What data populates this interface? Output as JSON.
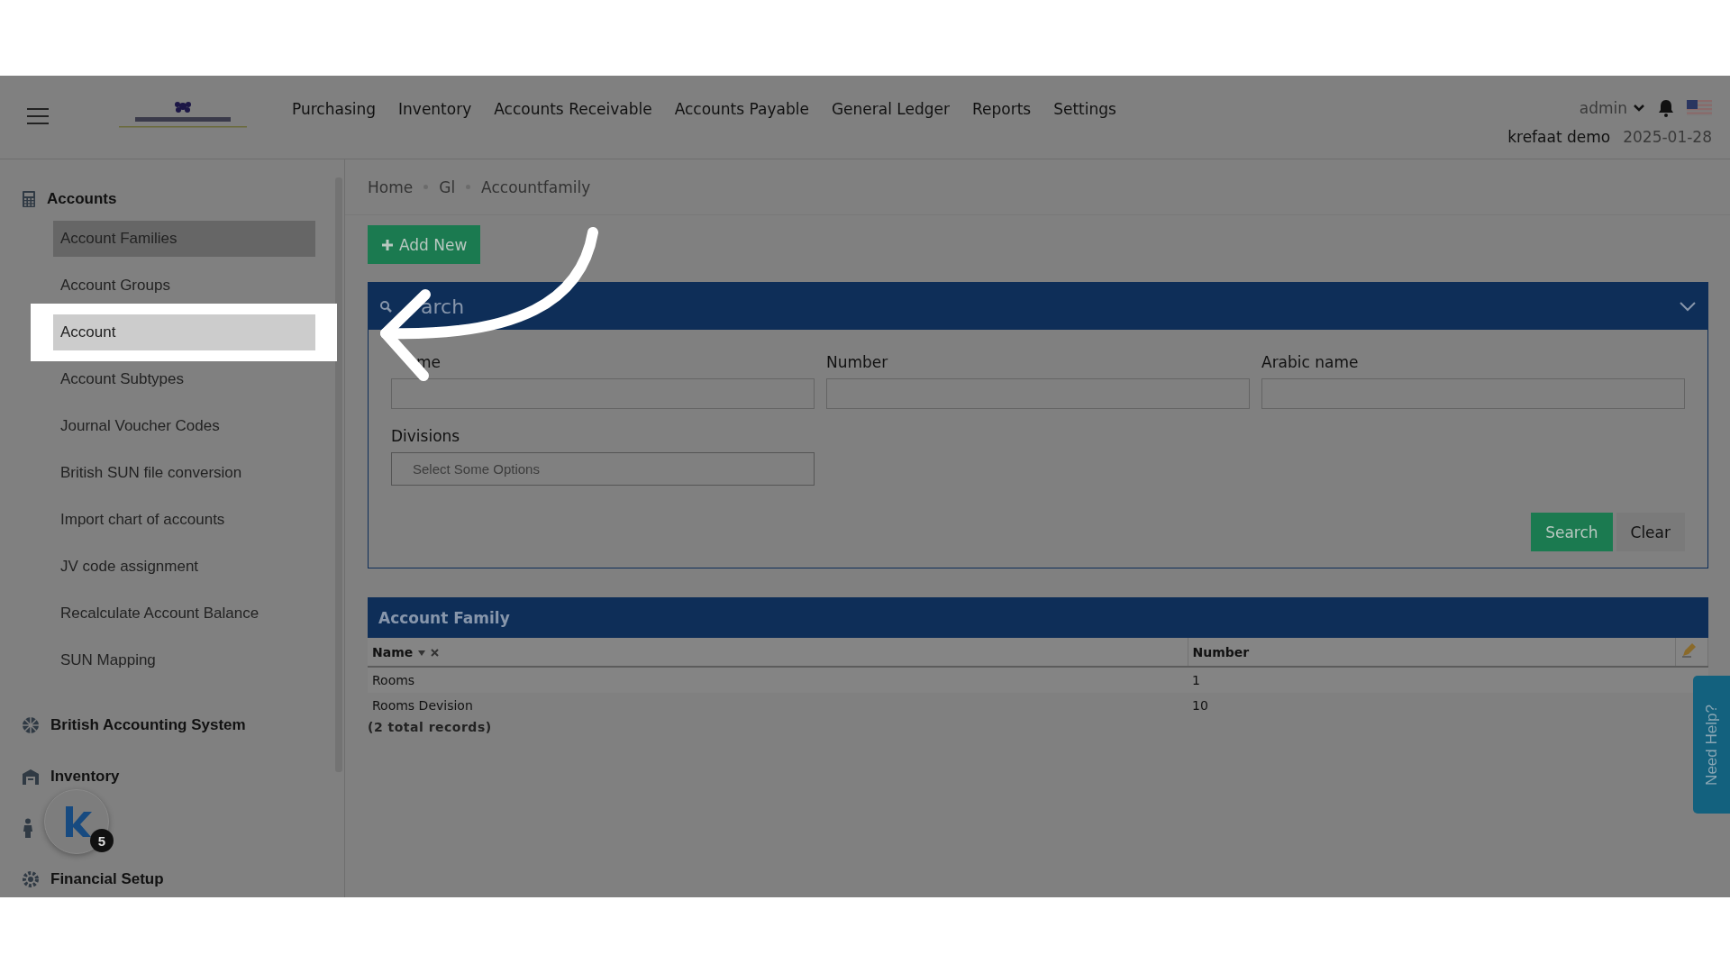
{
  "header": {
    "nav": [
      "Purchasing",
      "Inventory",
      "Accounts Receivable",
      "Accounts Payable",
      "General Ledger",
      "Reports",
      "Settings"
    ],
    "user": "admin",
    "account_name": "krefaat demo",
    "date": "2025-01-28"
  },
  "sidebar": {
    "groups": [
      {
        "label": "Accounts",
        "kind": "group",
        "children": [
          {
            "label": "Account Families",
            "selected": true,
            "highlighted": false
          },
          {
            "label": "Account Groups",
            "selected": false,
            "highlighted": false
          },
          {
            "label": "Account",
            "selected": false,
            "highlighted": true
          },
          {
            "label": "Account Subtypes",
            "selected": false,
            "highlighted": false
          },
          {
            "label": "Journal Voucher Codes",
            "selected": false,
            "highlighted": false
          },
          {
            "label": "British SUN file conversion",
            "selected": false,
            "highlighted": false
          },
          {
            "label": "Import chart of accounts",
            "selected": false,
            "highlighted": false
          },
          {
            "label": "JV code assignment",
            "selected": false,
            "highlighted": false
          },
          {
            "label": "Recalculate Account Balance",
            "selected": false,
            "highlighted": false
          },
          {
            "label": "SUN Mapping",
            "selected": false,
            "highlighted": false
          }
        ]
      },
      {
        "label": "British Accounting System",
        "kind": "group"
      },
      {
        "label": "Inventory",
        "kind": "group"
      },
      {
        "kind": "covered"
      },
      {
        "label": "Financial Setup",
        "kind": "group"
      }
    ]
  },
  "breadcrumb": [
    "Home",
    "Gl",
    "Accountfamily"
  ],
  "add_button": "Add New",
  "search_panel": {
    "title": "arch",
    "expanded": true,
    "fields": [
      {
        "label": "me",
        "kind": "text"
      },
      {
        "label": "Number",
        "kind": "text"
      },
      {
        "label": "Arabic name",
        "kind": "text"
      },
      {
        "label": "Divisions",
        "kind": "select",
        "placeholder": "Select Some Options"
      }
    ],
    "buttons": [
      {
        "label": "Search",
        "kind": "primary"
      },
      {
        "label": "Clear",
        "kind": "secondary"
      }
    ]
  },
  "table": {
    "title": "Account Family",
    "columns": [
      {
        "label": "Name",
        "sorted": true
      },
      {
        "label": "Number",
        "sorted": false
      }
    ],
    "rows": [
      [
        "Rooms",
        "1"
      ],
      [
        "Rooms Devision",
        "10"
      ]
    ],
    "footer": "(2 total records)"
  },
  "help_tab": "Need Help?",
  "chat_badge": "5"
}
